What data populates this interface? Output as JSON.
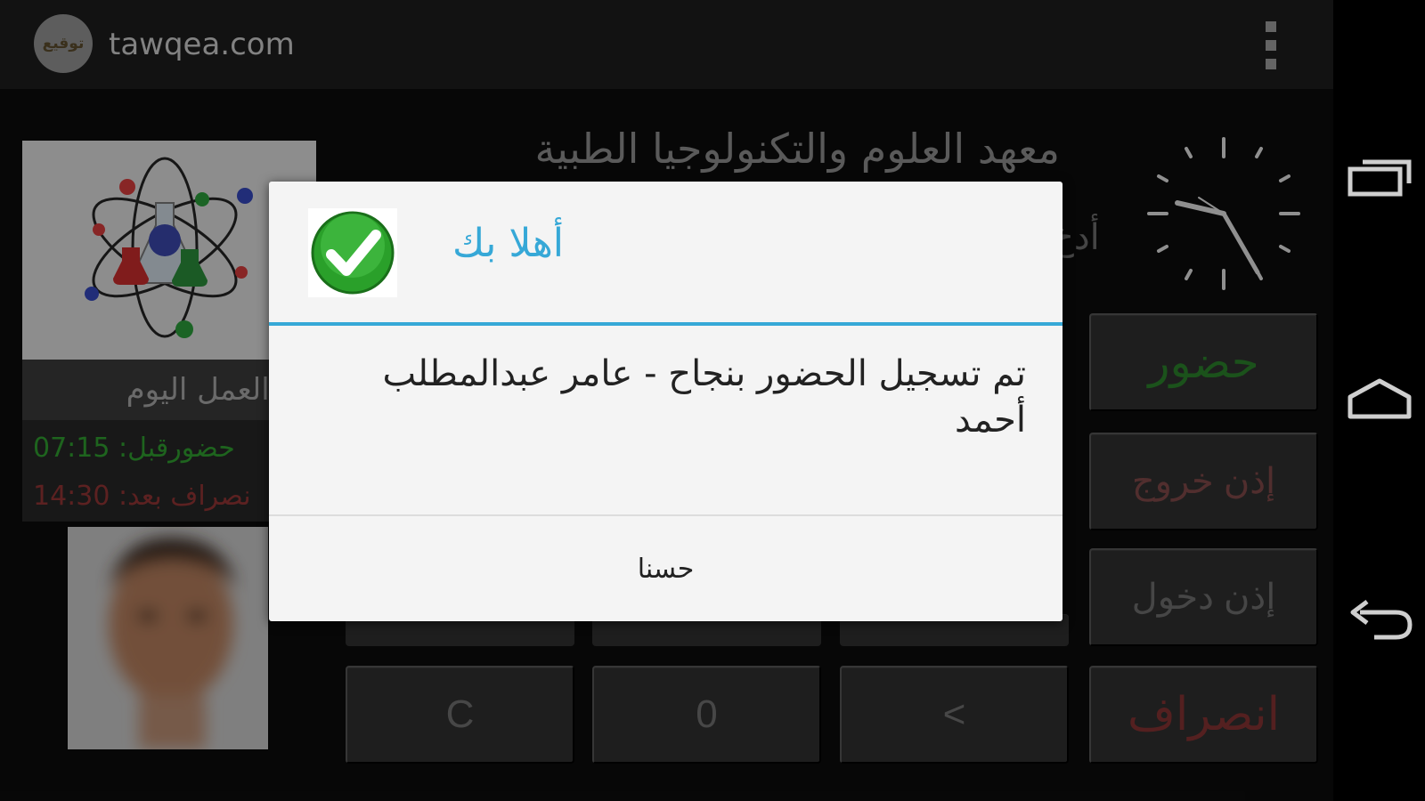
{
  "actionbar": {
    "logo_text": "توقيع",
    "title": "tawqea.com",
    "overflow_icon": "overflow-menu-icon"
  },
  "institute_name": "معهد العلوم والتكنولوجيا الطبية",
  "enter_hint": "أدخ",
  "work_hours": {
    "title": "ات العمل اليوم",
    "check_in": "حضورقبل: 07:15",
    "check_out": "نصراف بعد: 14:30"
  },
  "side_buttons": {
    "attendance": "حضور",
    "exit_permission": "إذن خروج",
    "entry_permission": "إذن دخول",
    "departure": "انصراف"
  },
  "keypad": {
    "clear": "C",
    "zero": "0",
    "back": "<"
  },
  "dialog": {
    "title": "أهلا بك",
    "message": "تم تسجيل الحضور بنجاح - عامر عبدالمطلب أحمد",
    "ok": "حسنا",
    "icon": "check-icon",
    "accent": "#36a8d7"
  },
  "navbar": {
    "icons": [
      "recent-apps-icon",
      "home-icon",
      "back-icon"
    ]
  },
  "colors": {
    "green": "#2a7e2a",
    "red": "#823232",
    "dialog_bg": "#f4f4f4"
  }
}
